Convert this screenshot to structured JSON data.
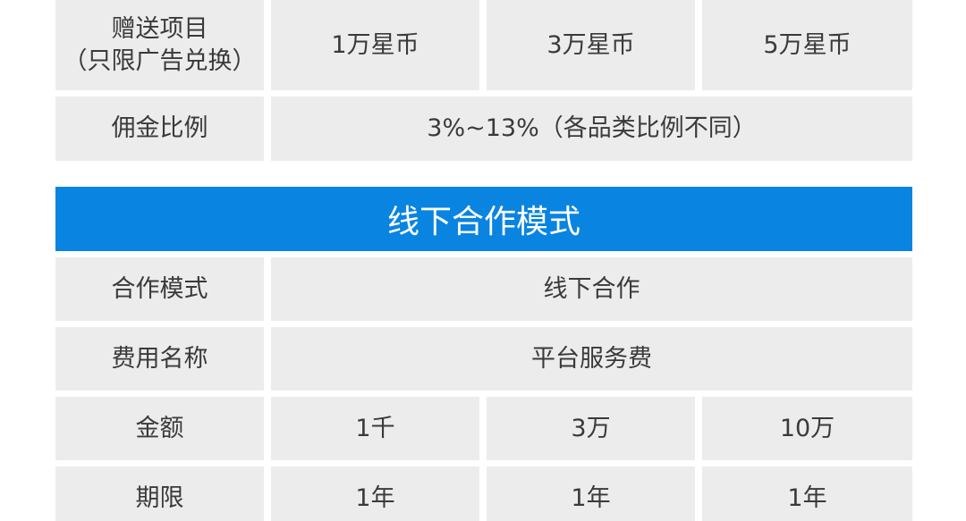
{
  "gift_section": {
    "row_gift": {
      "label_line1": "赠送项目",
      "label_line2": "（只限广告兑换）",
      "values": [
        "1万星币",
        "3万星币",
        "5万星币"
      ]
    },
    "row_commission": {
      "label": "佣金比例",
      "value": "3%~13%（各品类比例不同）"
    }
  },
  "offline_section": {
    "title": "线下合作模式",
    "row_mode": {
      "label": "合作模式",
      "value": "线下合作"
    },
    "row_fee_name": {
      "label": "费用名称",
      "value": "平台服务费"
    },
    "row_amount": {
      "label": "金额",
      "values": [
        "1千",
        "3万",
        "10万"
      ]
    },
    "row_period": {
      "label": "期限",
      "values": [
        "1年",
        "1年",
        "1年"
      ]
    }
  },
  "colors": {
    "banner": "#0a84e1",
    "cell_background": "#ececec",
    "text": "#3a3a3a"
  }
}
